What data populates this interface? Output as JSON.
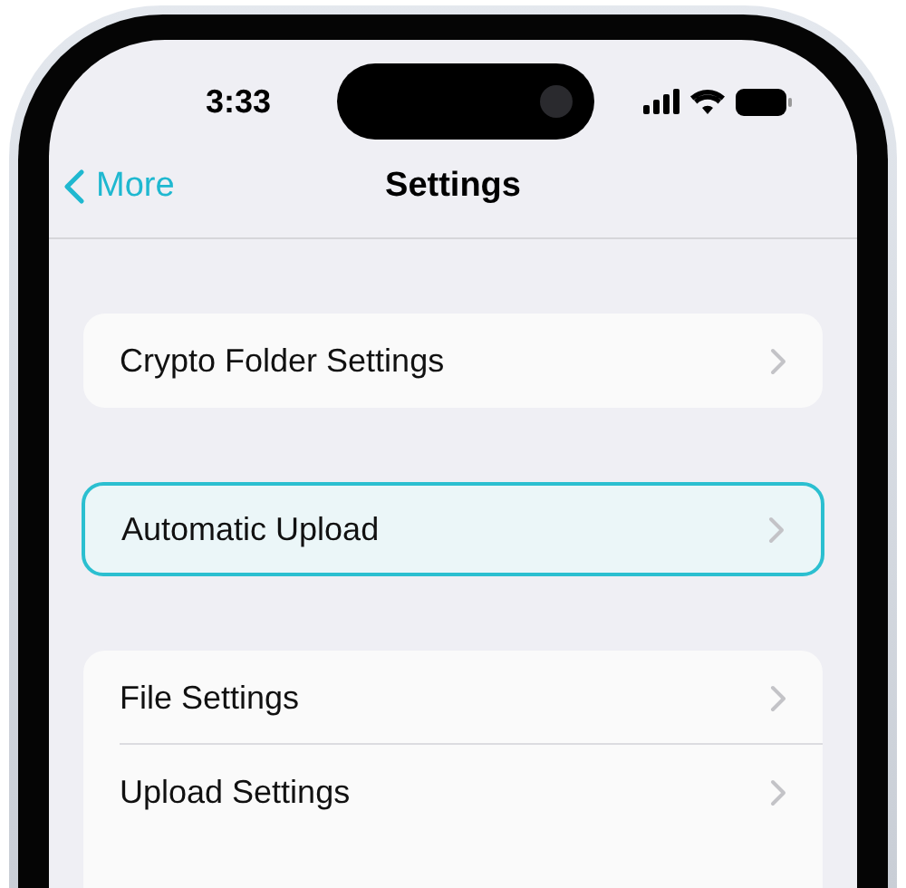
{
  "status_bar": {
    "time": "3:33"
  },
  "nav": {
    "back": "More",
    "title": "Settings"
  },
  "groups": [
    {
      "items": [
        {
          "label": "Crypto Folder Settings",
          "selected": false
        }
      ]
    },
    {
      "items": [
        {
          "label": "Automatic Upload",
          "selected": true
        }
      ]
    },
    {
      "items": [
        {
          "label": "File Settings",
          "selected": false
        },
        {
          "label": "Upload Settings",
          "selected": false
        }
      ]
    }
  ]
}
